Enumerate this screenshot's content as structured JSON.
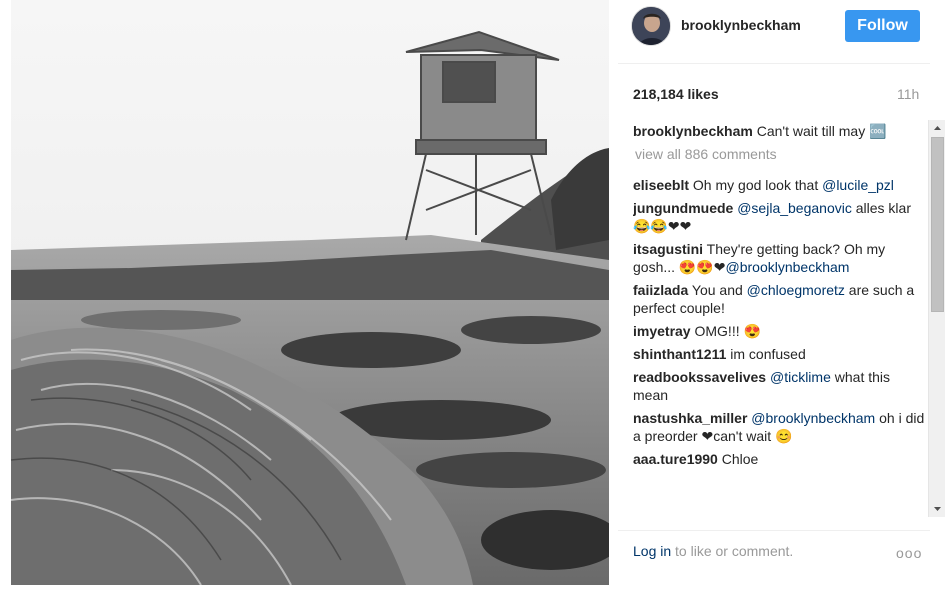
{
  "post": {
    "image_alt": "Black and white photo of hair in foreground with a lifeguard tower on a beach"
  },
  "header": {
    "username": "brooklynbeckham",
    "follow_label": "Follow"
  },
  "stats": {
    "likes": "218,184 likes",
    "time": "11h"
  },
  "caption": {
    "user": "brooklynbeckham",
    "text": " Can't wait till may 🆒"
  },
  "view_all": "view all 886 comments",
  "comments": [
    {
      "user": "eliseeblt",
      "text": " Oh my god look that ",
      "mention": "@lucile_pzl",
      "after": ""
    },
    {
      "user": "jungundmuede",
      "text": " ",
      "mention": "@sejla_beganovic",
      "after": " alles klar😂😂❤❤"
    },
    {
      "user": "itsagustini",
      "text": " They're getting back? Oh my gosh... 😍😍❤",
      "mention": "@brooklynbeckham",
      "after": ""
    },
    {
      "user": "faiizlada",
      "text": " You and ",
      "mention": "@chloegmoretz",
      "after": " are such a perfect couple!"
    },
    {
      "user": "imyetray",
      "text": " OMG!!! 😍",
      "mention": "",
      "after": ""
    },
    {
      "user": "shinthant1211",
      "text": " im confused",
      "mention": "",
      "after": ""
    },
    {
      "user": "readbookssavelives",
      "text": " ",
      "mention": "@ticklime",
      "after": " what this mean"
    },
    {
      "user": "nastushka_miller",
      "text": " ",
      "mention": "@brooklynbeckham",
      "after": " oh i did a preorder ❤can't wait 😊"
    },
    {
      "user": "aaa.ture1990",
      "text": " Chloe",
      "mention": "",
      "after": ""
    }
  ],
  "footer": {
    "login_link": "Log in",
    "login_text": " to like or comment.",
    "more": "ooo"
  },
  "colors": {
    "follow_bg": "#3897f0",
    "mention": "#003569",
    "muted": "#999999"
  }
}
